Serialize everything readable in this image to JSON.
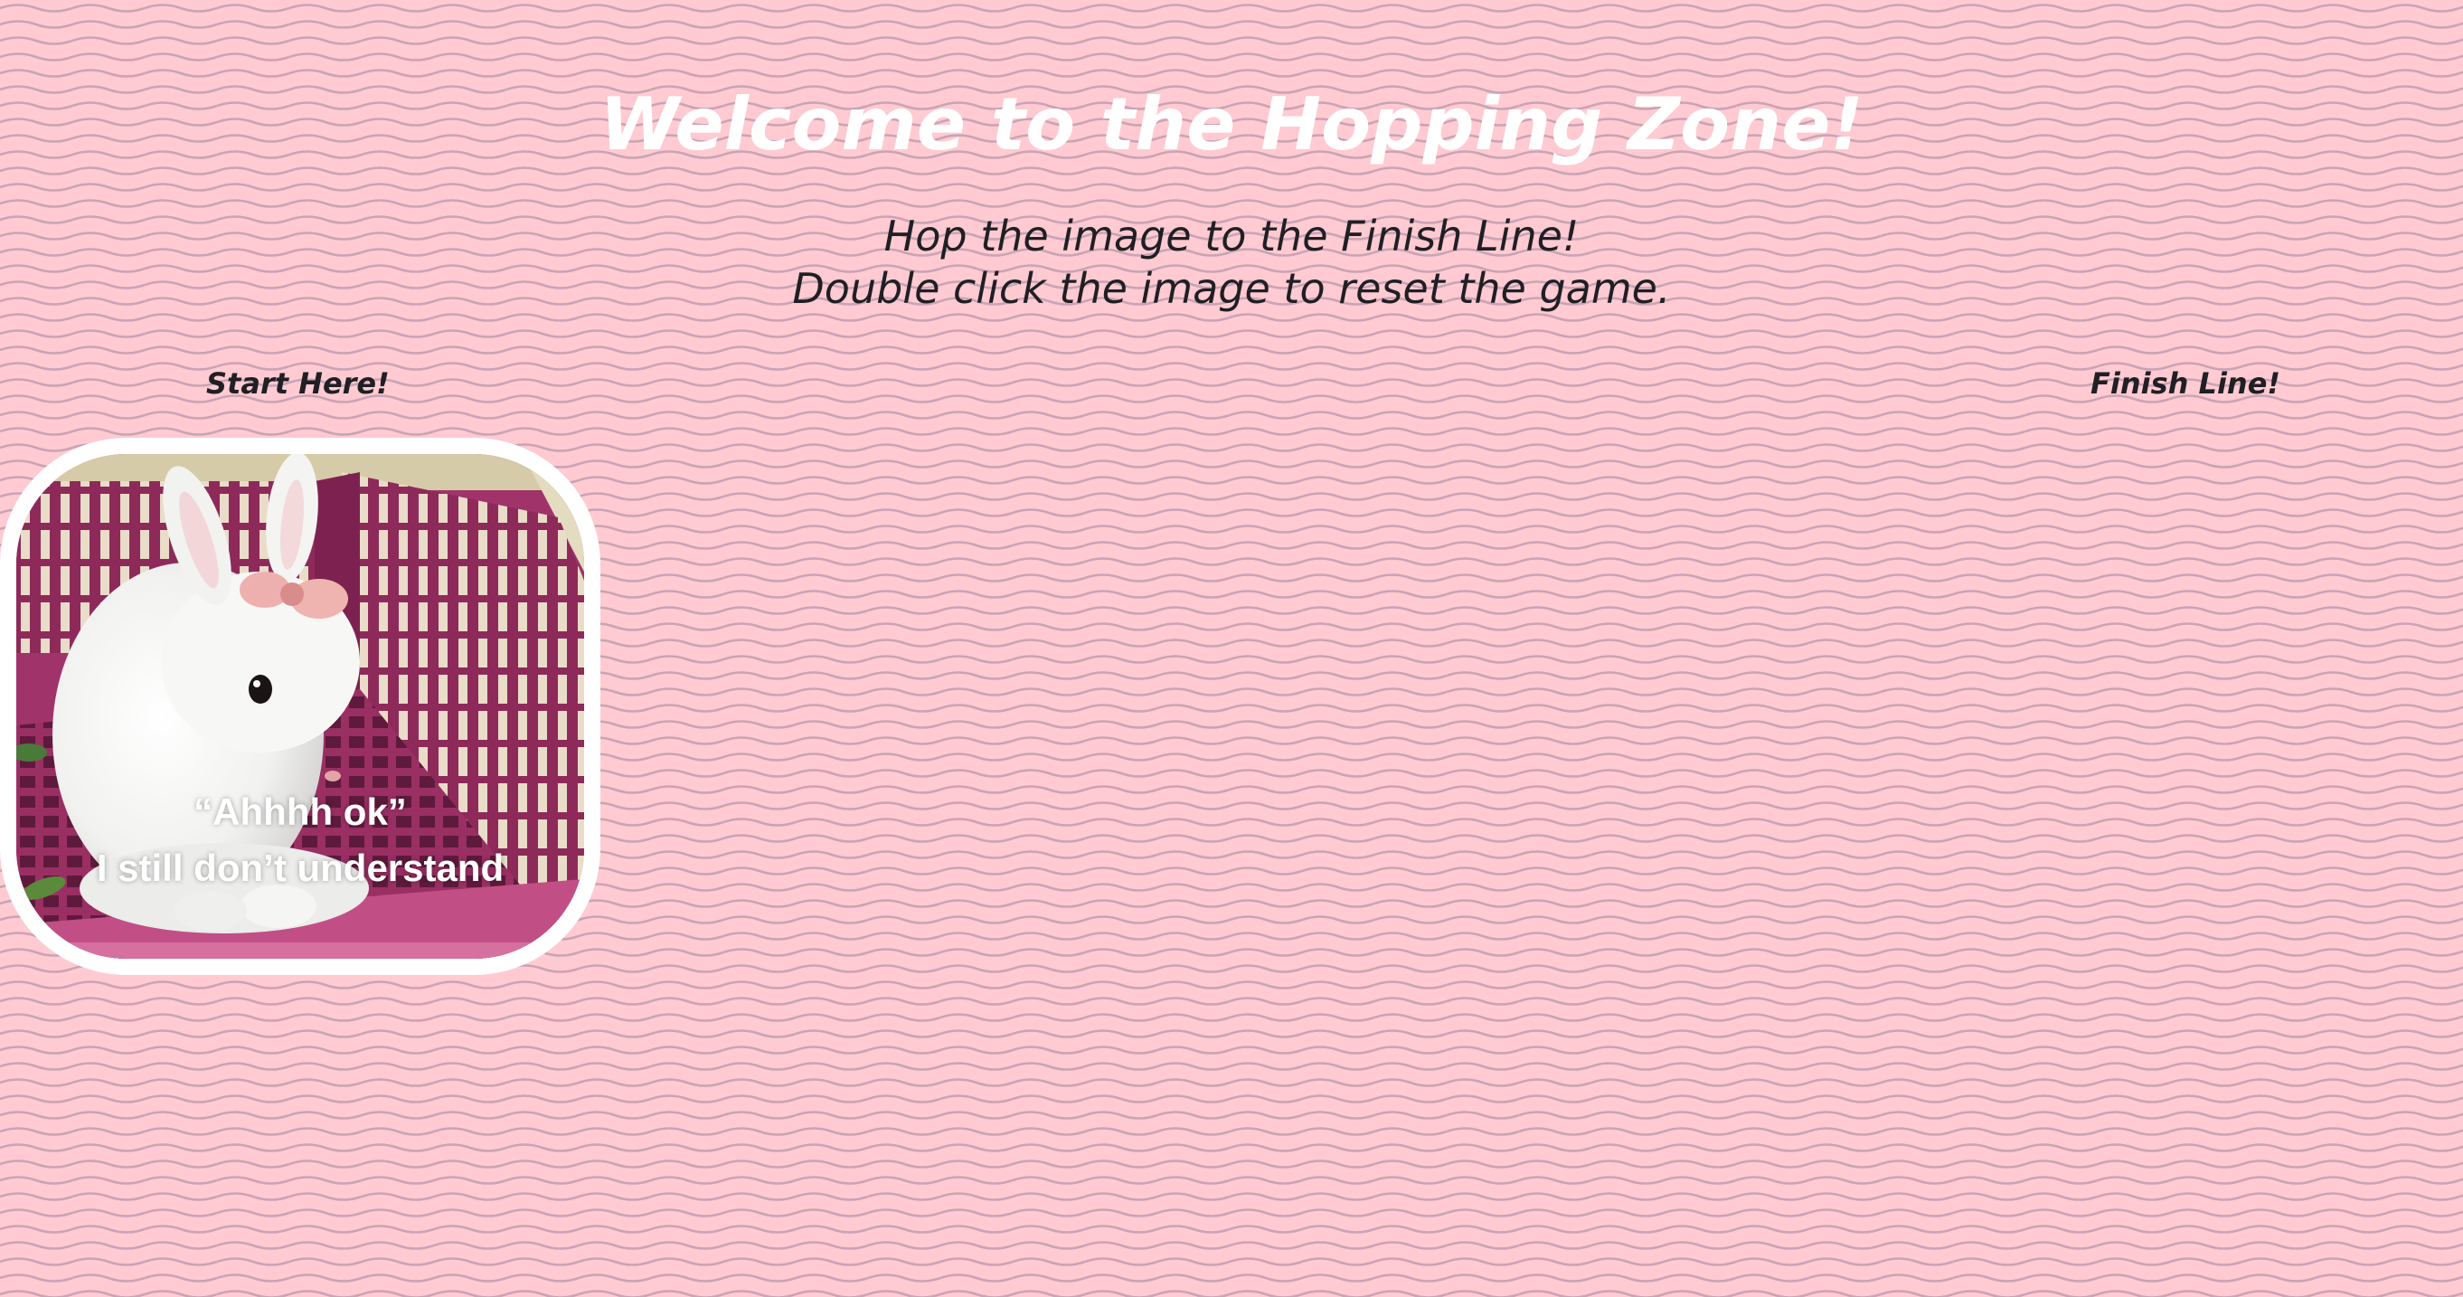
{
  "header": {
    "title": "Welcome to the Hopping Zone!",
    "instruction_line_1": "Hop the image to the Finish Line!",
    "instruction_line_2": "Double click the image to reset the game."
  },
  "lane": {
    "start_label": "Start Here!",
    "finish_label": "Finish Line!"
  },
  "hopper_image": {
    "subject": "white bunny with pink bow in magenta basket",
    "caption_line_1": "“Ahhhh ok”",
    "caption_line_2": "I still don’t understand"
  },
  "colors": {
    "background": "#ffcad2",
    "wave_lines": "#c8a4b4",
    "title": "#ffffff",
    "text": "#1f1f24",
    "image_border": "#ffffff",
    "basket": "#8e2a5a"
  }
}
